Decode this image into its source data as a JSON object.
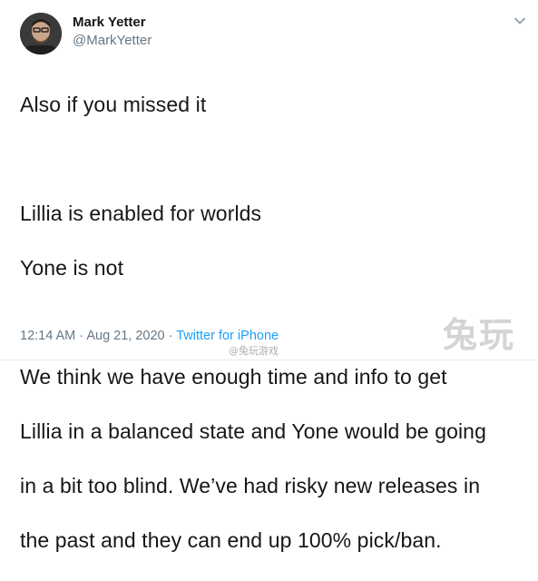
{
  "tweet": {
    "author_name": "Mark Yetter",
    "author_handle": "@MarkYetter",
    "lines": [
      "Also if you missed it",
      "",
      "Lillia is enabled for worlds",
      "Yone is not",
      "",
      "We think we have enough time and info to get",
      "Lillia in a balanced state and Yone would be going",
      "in a bit too blind. We’ve had risky new releases in",
      "the past and they can end up 100% pick/ban."
    ],
    "time": "12:14 AM · Aug 21, 2020 · ",
    "source": "Twitter for iPhone"
  },
  "watermark": {
    "logo_text": "兔玩",
    "weibo_text": "@兔玩游戏"
  },
  "colors": {
    "text": "#14171a",
    "secondary": "#657786",
    "link": "#1da1f2"
  },
  "icons": {
    "menu": "chevron-down-icon"
  }
}
